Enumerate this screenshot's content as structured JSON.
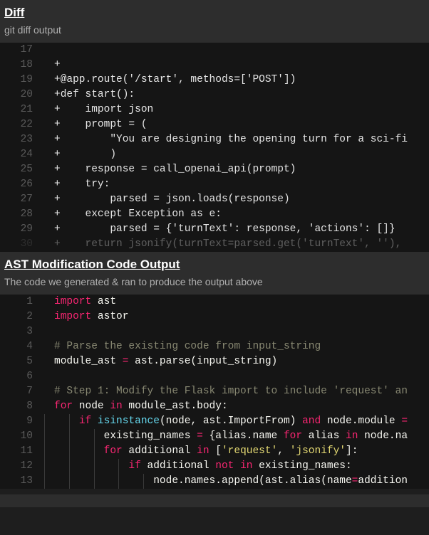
{
  "diff": {
    "title": "Diff",
    "subtitle": "git diff output",
    "lines": [
      {
        "num": "17",
        "text": " "
      },
      {
        "num": "18",
        "text": "+"
      },
      {
        "num": "19",
        "text": "+@app.route('/start', methods=['POST'])"
      },
      {
        "num": "20",
        "text": "+def start():"
      },
      {
        "num": "21",
        "text": "+    import json"
      },
      {
        "num": "22",
        "text": "+    prompt = ("
      },
      {
        "num": "23",
        "text": "+        \"You are designing the opening turn for a sci-fi"
      },
      {
        "num": "24",
        "text": "+        )"
      },
      {
        "num": "25",
        "text": "+    response = call_openai_api(prompt)"
      },
      {
        "num": "26",
        "text": "+    try:"
      },
      {
        "num": "27",
        "text": "+        parsed = json.loads(response)"
      },
      {
        "num": "28",
        "text": "+    except Exception as e:"
      },
      {
        "num": "29",
        "text": "+        parsed = {'turnText': response, 'actions': []}"
      },
      {
        "num": "30",
        "text": "+    return jsonify(turnText=parsed.get('turnText', ''),"
      }
    ]
  },
  "ast": {
    "title": "AST Modification Code Output",
    "subtitle": "The code we generated & ran to produce the output above",
    "lines": [
      {
        "num": "1",
        "html": "<span class='c-red'>import</span> ast"
      },
      {
        "num": "2",
        "html": "<span class='c-red'>import</span> astor"
      },
      {
        "num": "3",
        "html": ""
      },
      {
        "num": "4",
        "html": "<span class='c-grey'># Parse the existing code from input_string</span>"
      },
      {
        "num": "5",
        "html": "module_ast <span class='c-red'>=</span> ast.parse(input_string)"
      },
      {
        "num": "6",
        "html": ""
      },
      {
        "num": "7",
        "html": "<span class='c-grey'># Step 1: Modify the Flask import to include 'request' an</span>"
      },
      {
        "num": "8",
        "html": "<span class='c-red'>for</span> node <span class='c-red'>in</span> module_ast.body:"
      },
      {
        "num": "9",
        "html": "    <span class='c-red'>if</span> <span class='c-blue'>isinstance</span>(node, ast.ImportFrom) <span class='c-red'>and</span> node.module <span class='c-red'>=</span>"
      },
      {
        "num": "10",
        "html": "        existing_names <span class='c-red'>=</span> {alias.name <span class='c-red'>for</span> alias <span class='c-red'>in</span> node.na"
      },
      {
        "num": "11",
        "html": "        <span class='c-red'>for</span> additional <span class='c-red'>in</span> [<span class='c-yellow'>'request'</span>, <span class='c-yellow'>'jsonify'</span>]:"
      },
      {
        "num": "12",
        "html": "            <span class='c-red'>if</span> additional <span class='c-red'>not</span> <span class='c-red'>in</span> existing_names:"
      },
      {
        "num": "13",
        "html": "                node.names.append(ast.alias(name<span class='c-red'>=</span>addition"
      }
    ]
  }
}
